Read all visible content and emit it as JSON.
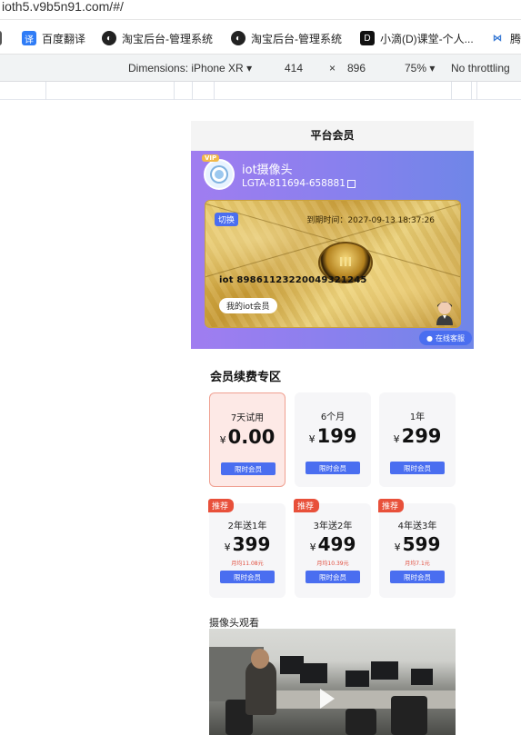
{
  "browser": {
    "url": "ioth5.v9b5n91.com/#/",
    "bookmarks": [
      {
        "label": "百度翻译",
        "icon": "translate-icon"
      },
      {
        "label": "淘宝后台-管理系统",
        "icon": "globe-icon"
      },
      {
        "label": "淘宝后台-管理系统",
        "icon": "globe-icon"
      },
      {
        "label": "小滴(D)课堂-个人...",
        "icon": "d-logo-icon"
      },
      {
        "label": "腾",
        "icon": "bowtie-logo-icon"
      }
    ],
    "devtools": {
      "dimensions_label": "Dimensions: iPhone XR",
      "width": "414",
      "times": "×",
      "height": "896",
      "zoom": "75%",
      "throttling": "No throttling"
    }
  },
  "app": {
    "nav_title": "平台会员",
    "device": {
      "vip_tag": "VIP",
      "name": "iot摄像头",
      "id": "LGTA-811694-658881"
    },
    "card": {
      "switch_label": "切换",
      "expire_label": "到期时间：2027-09-13 18:37:26",
      "emblem_text": "III",
      "number": "iot 89861123220049321245",
      "my_member_label": "我的iot会员"
    },
    "customer_service_label": "在线客服",
    "renewal": {
      "title": "会员续费专区",
      "currency": "¥",
      "recommend_label": "推荐",
      "plans_top": [
        {
          "name": "7天试用",
          "price": "0.00",
          "button": "限时会员",
          "selected": true
        },
        {
          "name": "6个月",
          "price": "199",
          "button": "限时会员",
          "selected": false
        },
        {
          "name": "1年",
          "price": "299",
          "button": "限时会员",
          "selected": false
        }
      ],
      "plans_bottom": [
        {
          "name": "2年送1年",
          "price": "399",
          "per_month": "月均11.08元",
          "button": "限时会员"
        },
        {
          "name": "3年送2年",
          "price": "499",
          "per_month": "月均10.39元",
          "button": "限时会员"
        },
        {
          "name": "4年送3年",
          "price": "599",
          "per_month": "月均7.1元",
          "button": "限时会员"
        }
      ]
    },
    "camera": {
      "title": "摄像头观看"
    }
  },
  "colors": {
    "accent_blue": "#4a6ef0",
    "recommend_red": "#e8503a",
    "hero_start": "#a07df0",
    "hero_end": "#6f86e8"
  }
}
